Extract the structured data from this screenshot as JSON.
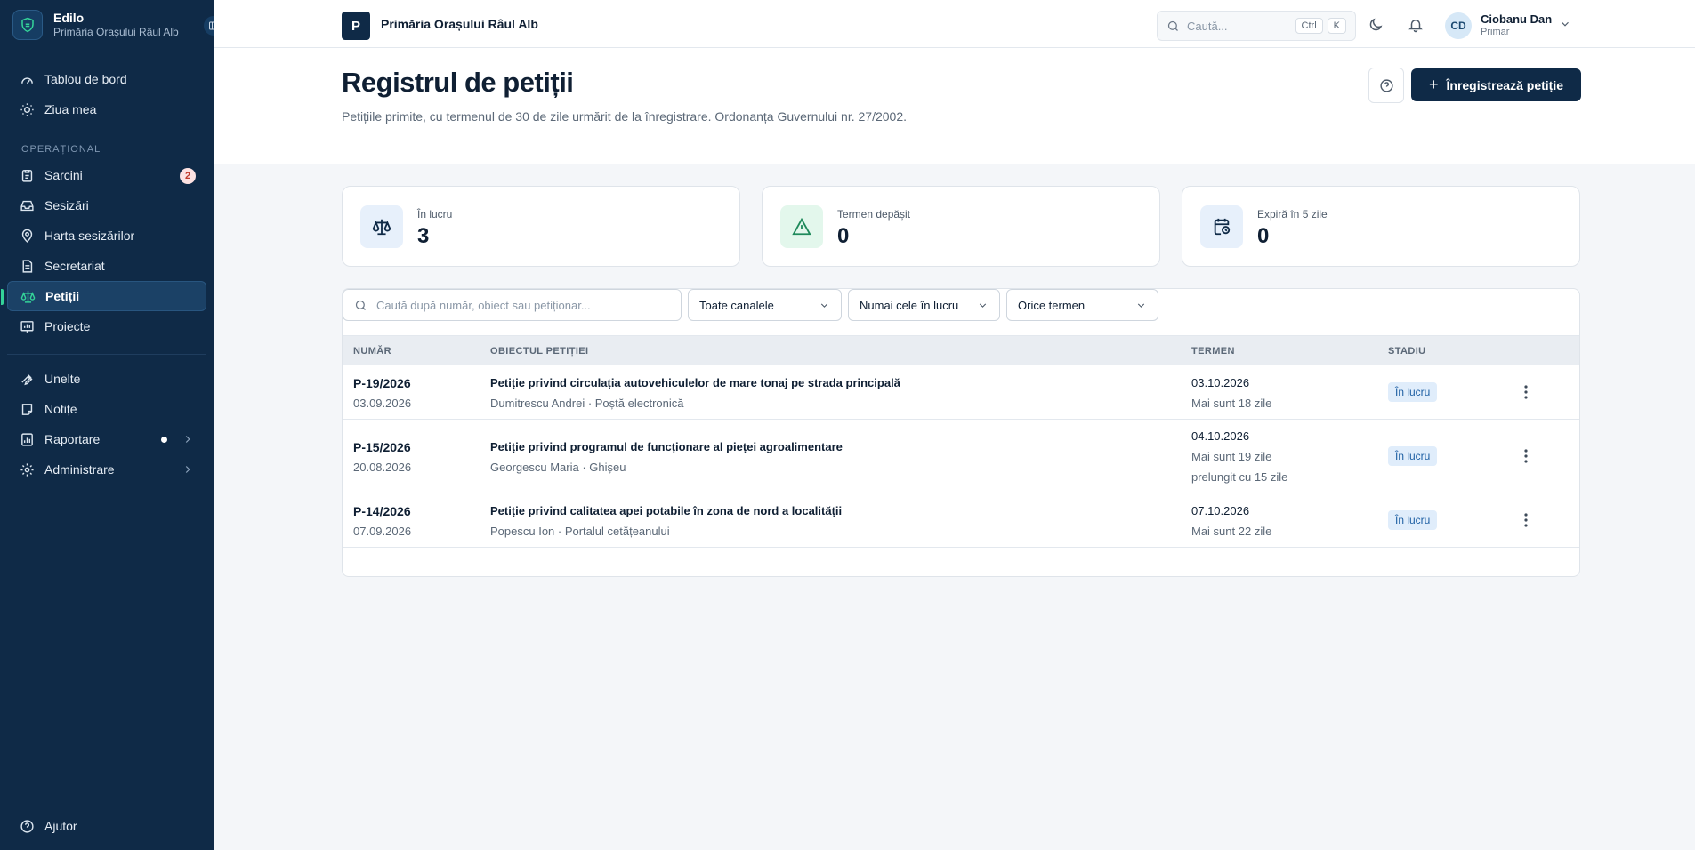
{
  "sidebar": {
    "app_name": "Edilo",
    "org_name": "Primăria Orașului Râul Alb",
    "items_top": [
      {
        "label": "Tablou de bord",
        "icon": "dashboard-gauge-icon"
      },
      {
        "label": "Ziua mea",
        "icon": "sun-icon"
      }
    ],
    "section_label": "OPERAȚIONAL",
    "items_ops": [
      {
        "label": "Sarcini",
        "icon": "clipboard-icon",
        "badge": "2"
      },
      {
        "label": "Sesizări",
        "icon": "inbox-icon"
      },
      {
        "label": "Harta sesizărilor",
        "icon": "map-pin-icon"
      },
      {
        "label": "Secretariat",
        "icon": "document-icon"
      },
      {
        "label": "Petiții",
        "icon": "scale-icon",
        "active": true
      },
      {
        "label": "Proiecte",
        "icon": "chart-board-icon"
      }
    ],
    "items_tools": [
      {
        "label": "Unelte",
        "icon": "wrench-icon"
      },
      {
        "label": "Notițe",
        "icon": "note-icon"
      },
      {
        "label": "Raportare",
        "icon": "report-icon"
      },
      {
        "label": "Administrare",
        "icon": "gear-icon"
      }
    ],
    "help_label": "Ajutor"
  },
  "topbar": {
    "org_initial": "P",
    "org_name": "Primăria Orașului Râul Alb",
    "search_placeholder": "Caută...",
    "shortcut_keys": [
      "Ctrl",
      "K"
    ],
    "user_initials": "CD",
    "user_name": "Ciobanu Dan",
    "user_role": "Primar"
  },
  "page": {
    "title": "Registrul de petiții",
    "description": "Petițiile primite, cu termenul de 30 de zile urmărit de la înregistrare. Ordonanța Guvernului nr. 27/2002.",
    "primary_action": "Înregistrează petiție"
  },
  "stats": [
    {
      "label": "În lucru",
      "value": "3",
      "icon": "scale-icon",
      "color": "#e7f0fb"
    },
    {
      "label": "Termen depășit",
      "value": "0",
      "icon": "warning-triangle-icon",
      "color": "#e3f7ec"
    },
    {
      "label": "Expiră în 5 zile",
      "value": "0",
      "icon": "calendar-clock-icon",
      "color": "#e7f0fb"
    }
  ],
  "filters": {
    "search_placeholder": "Caută după număr, obiect sau petiționar...",
    "channel": "Toate canalele",
    "status": "Numai cele în lucru",
    "term": "Orice termen"
  },
  "table": {
    "headers": [
      "NUMĂR",
      "OBIECTUL PETIȚIEI",
      "TERMEN",
      "STADIU"
    ],
    "rows": [
      {
        "number": "P-19/2026",
        "date": "03.09.2026",
        "subject": "Petiție privind circulația autovehiculelor de mare tonaj pe strada principală",
        "meta": "Dumitrescu Andrei · Poștă electronică",
        "deadline": "03.10.2026",
        "remaining": "Mai sunt 18 zile",
        "extension": "",
        "status": "În lucru"
      },
      {
        "number": "P-15/2026",
        "date": "20.08.2026",
        "subject": "Petiție privind programul de funcționare al pieței agroalimentare",
        "meta": "Georgescu Maria · Ghișeu",
        "deadline": "04.10.2026",
        "remaining": "Mai sunt 19 zile",
        "extension": "prelungit cu 15 zile",
        "status": "În lucru"
      },
      {
        "number": "P-14/2026",
        "date": "07.09.2026",
        "subject": "Petiție privind calitatea apei potabile în zona de nord a localității",
        "meta": "Popescu Ion · Portalul cetățeanului",
        "deadline": "07.10.2026",
        "remaining": "Mai sunt 22 zile",
        "extension": "",
        "status": "În lucru"
      }
    ]
  },
  "colors": {
    "sidebar": "#0f2a47",
    "accent": "#34d399",
    "primary": "#0f2a47",
    "badge_bg": "#fde2e2",
    "status_bg": "#e0edfb"
  }
}
